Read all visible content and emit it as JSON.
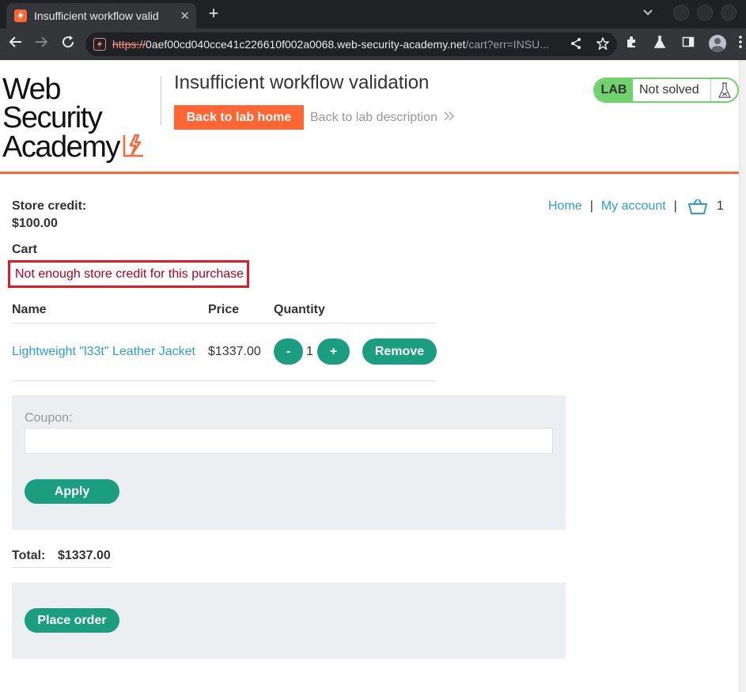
{
  "browser": {
    "tab_title": "Insufficient workflow valid",
    "tab_close": "✕",
    "new_tab": "+",
    "url_scheme": "https://",
    "url_host": "0aef00cd040cce41c226610f002a0068.web-security-academy.net",
    "url_rest": "/cart?err=INSU..."
  },
  "header": {
    "logo_line1": "Web Security",
    "logo_line2": "Academy",
    "lab_title": "Insufficient workflow validation",
    "back_home": "Back to lab home",
    "back_description": "Back to lab description",
    "lab_badge": "LAB",
    "lab_status": "Not solved"
  },
  "store": {
    "credit_label": "Store credit:",
    "credit_value": "$100.00"
  },
  "nav": {
    "home": "Home",
    "separator": "|",
    "my_account": "My account",
    "cart_count": "1"
  },
  "cart": {
    "heading": "Cart",
    "error": "Not enough store credit for this purchase",
    "columns": [
      "Name",
      "Price",
      "Quantity"
    ],
    "item": {
      "name": "Lightweight \"l33t\" Leather Jacket",
      "price": "$1337.00",
      "quantity": "1",
      "decrement": "-",
      "increment": "+",
      "remove": "Remove"
    },
    "coupon_label": "Coupon:",
    "coupon_value": "",
    "apply": "Apply",
    "total_label": "Total:",
    "total_value": "$1337.00",
    "place_order": "Place order"
  },
  "colors": {
    "brand_orange": "#ff6633",
    "action_green": "#1a9e7f",
    "lab_green": "#70d16d",
    "link_blue": "#2c9ed6",
    "error_red": "#e01b24"
  }
}
